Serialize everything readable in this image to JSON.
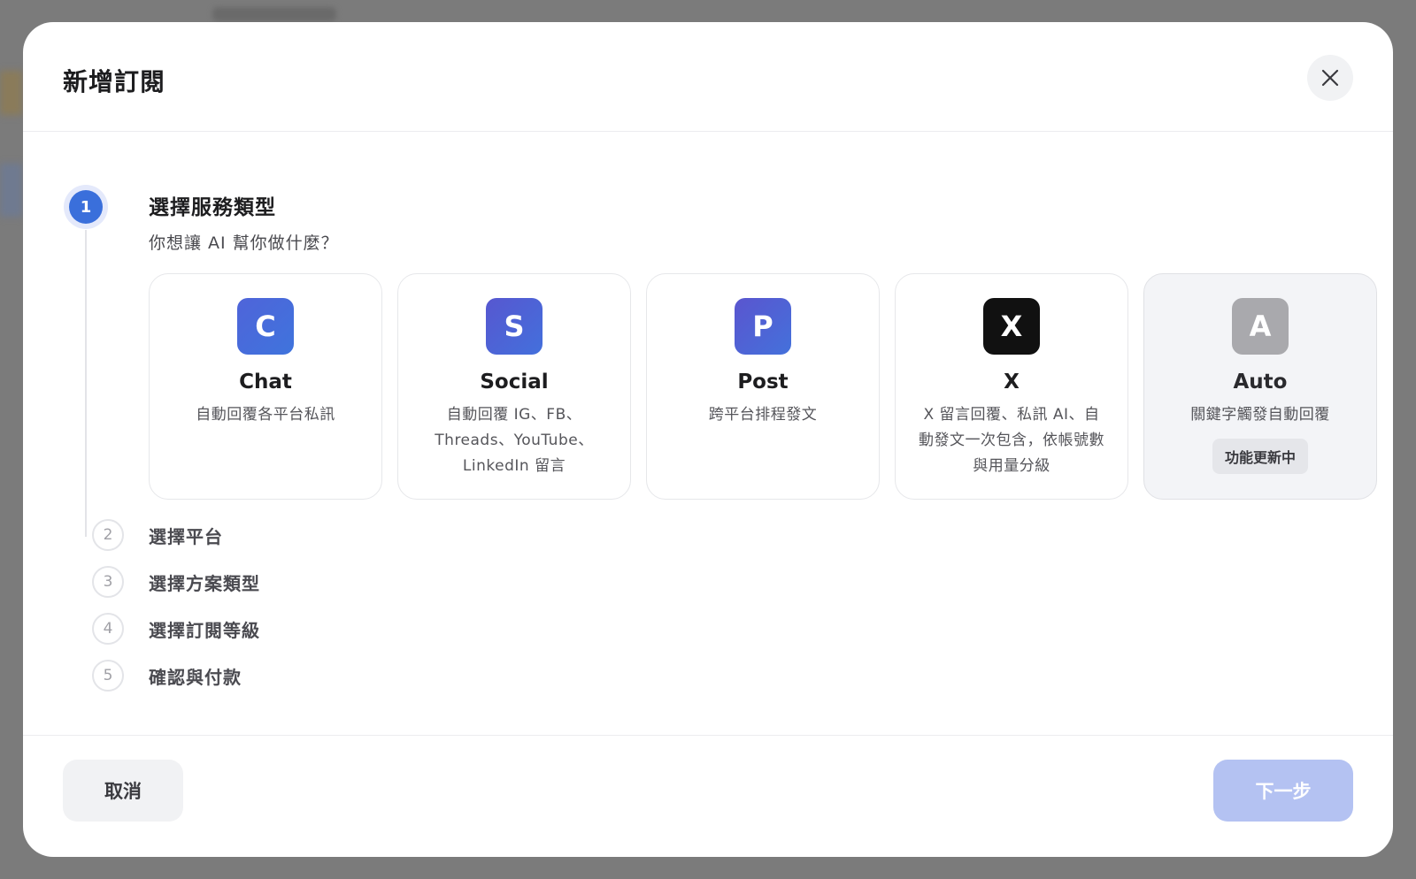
{
  "modal": {
    "title": "新增訂閱",
    "close_icon": "close-icon"
  },
  "step1": {
    "number": "1",
    "title": "選擇服務類型",
    "subtitle": "你想讓 AI 幫你做什麼？"
  },
  "cards": [
    {
      "letter": "C",
      "name": "Chat",
      "desc": "自動回覆各平台私訊"
    },
    {
      "letter": "S",
      "name": "Social",
      "desc": "自動回覆 IG、FB、Threads、YouTube、LinkedIn 留言"
    },
    {
      "letter": "P",
      "name": "Post",
      "desc": "跨平台排程發文"
    },
    {
      "letter": "X",
      "name": "X",
      "desc": "X 留言回覆、私訊 AI、自動發文一次包含，依帳號數與用量分級"
    },
    {
      "letter": "A",
      "name": "Auto",
      "desc": "關鍵字觸發自動回覆",
      "badge": "功能更新中"
    }
  ],
  "steps": [
    {
      "number": "2",
      "label": "選擇平台"
    },
    {
      "number": "3",
      "label": "選擇方案類型"
    },
    {
      "number": "4",
      "label": "選擇訂閱等級"
    },
    {
      "number": "5",
      "label": "確認與付款"
    }
  ],
  "footer": {
    "cancel_label": "取消",
    "next_label": "下一步"
  },
  "colors": {
    "accent": "#3a6fdb",
    "next_disabled": "#b4c2f2"
  }
}
